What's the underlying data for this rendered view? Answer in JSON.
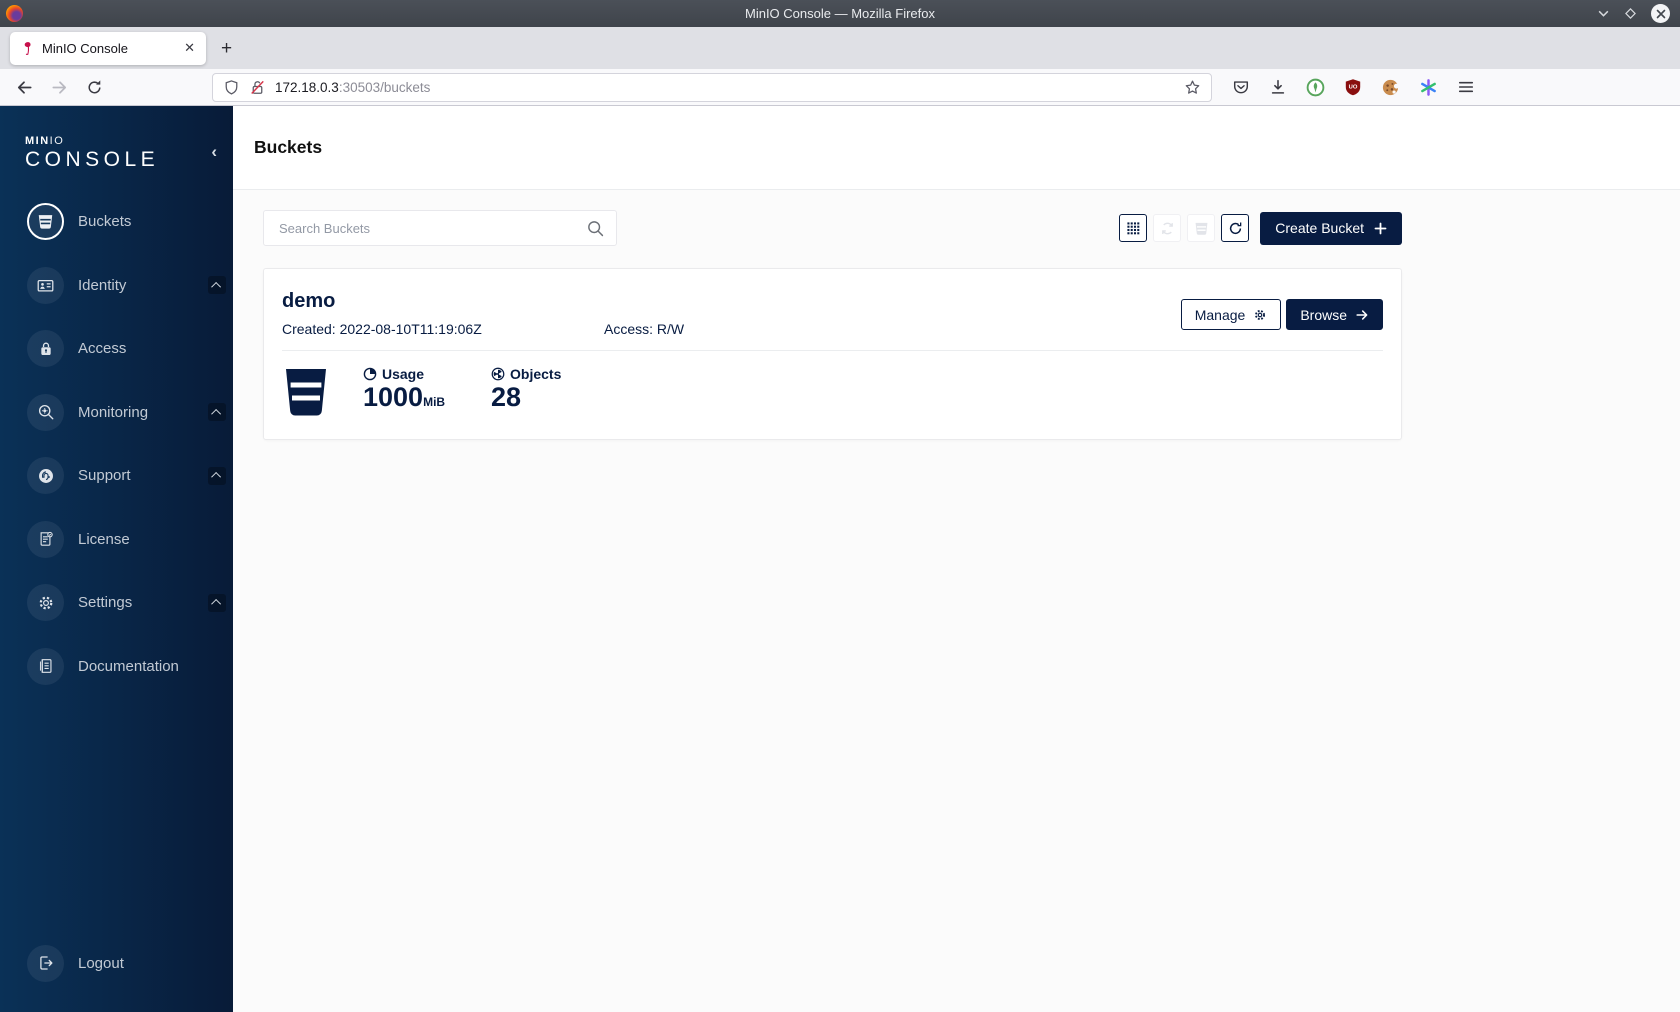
{
  "window": {
    "title": "MinIO Console — Mozilla Firefox"
  },
  "browser": {
    "tab_title": "MinIO Console",
    "close_glyph": "✕",
    "new_tab_glyph": "+",
    "url": {
      "host": "172.18.0.3",
      "path": ":30503/buckets"
    }
  },
  "sidebar": {
    "logo": {
      "min": "MIN",
      "io": "IO",
      "console": "CONSOLE",
      "collapse_glyph": "‹"
    },
    "items": [
      {
        "label": "Buckets",
        "icon": "bucket-icon",
        "active": true
      },
      {
        "label": "Identity",
        "icon": "id-card-icon",
        "expandable": true
      },
      {
        "label": "Access",
        "icon": "lock-icon"
      },
      {
        "label": "Monitoring",
        "icon": "monitoring-search-icon",
        "expandable": true
      },
      {
        "label": "Support",
        "icon": "support-icon",
        "expandable": true
      },
      {
        "label": "License",
        "icon": "license-icon"
      },
      {
        "label": "Settings",
        "icon": "gear-icon",
        "expandable": true
      },
      {
        "label": "Documentation",
        "icon": "documentation-icon"
      }
    ],
    "logout_label": "Logout"
  },
  "page": {
    "title": "Buckets",
    "search_placeholder": "Search Buckets",
    "create_bucket_label": "Create Bucket"
  },
  "bucket": {
    "name": "demo",
    "created": "Created: 2022-08-10T11:19:06Z",
    "access": "Access: R/W",
    "manage_label": "Manage",
    "browse_label": "Browse",
    "usage_label": "Usage",
    "usage_value": "1000",
    "usage_unit": "MiB",
    "objects_label": "Objects",
    "objects_value": "28"
  },
  "colors": {
    "brand_navy": "#081C42",
    "sidebar_gradient_start": "#0a3157",
    "sidebar_gradient_end": "#081b38",
    "minio_red": "#c7114c",
    "insecure_slash_red": "#d7354a"
  }
}
